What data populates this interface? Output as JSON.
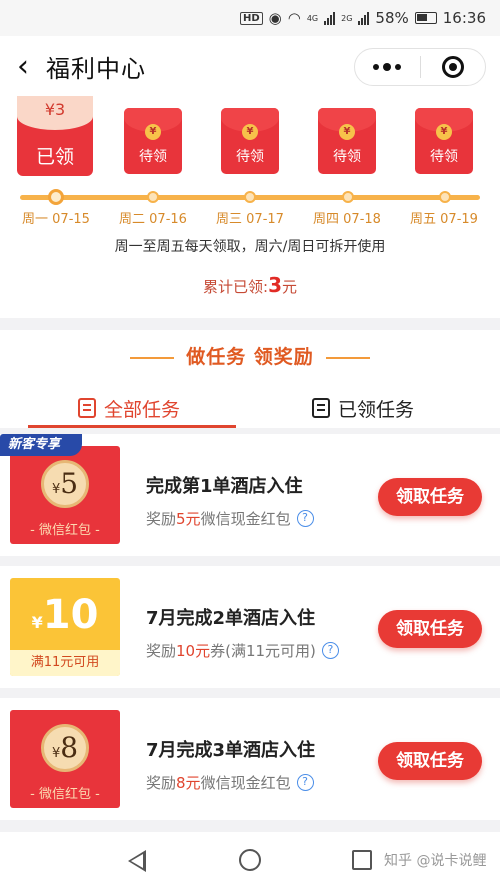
{
  "status_bar": {
    "battery": "58%",
    "time": "16:36",
    "hd": "HD",
    "net1": "4G",
    "net2": "2G"
  },
  "nav": {
    "back_icon": "chevron-left-icon",
    "title": "福利中心",
    "menu_icon": "more-dots-icon",
    "close_icon": "target-icon"
  },
  "checkin": {
    "claimed": {
      "amount": "¥3",
      "label": "已领"
    },
    "pending_label": "待领",
    "coin_glyph": "¥",
    "days": [
      "周一 07-15",
      "周二 07-16",
      "周三 07-17",
      "周四 07-18",
      "周五 07-19"
    ],
    "active_day": 0,
    "note": "周一至周五每天领取，周六/周日可拆开使用",
    "total_prefix": "累计已领:",
    "total_value": "3",
    "total_unit": "元"
  },
  "tasks_section": {
    "title": "做任务 领奖励",
    "tabs": [
      {
        "label": "全部任务",
        "active": true
      },
      {
        "label": "已领任务",
        "active": false
      }
    ]
  },
  "task_rows": [
    {
      "tag": "新客专享",
      "coupon": {
        "style": "red",
        "currency": "¥",
        "value": "5",
        "caption": "- 微信红包 -"
      },
      "title": "完成第1单酒店入住",
      "sub_prefix": "奖励",
      "sub_highlight": "5元",
      "sub_suffix": "微信现金红包",
      "button": "领取任务"
    },
    {
      "tag": "",
      "coupon": {
        "style": "yellow",
        "currency": "¥",
        "value": "10",
        "caption": "满11元可用"
      },
      "title": "7月完成2单酒店入住",
      "sub_prefix": "奖励",
      "sub_highlight": "10元",
      "sub_suffix": "券(满11元可用)",
      "button": "领取任务"
    },
    {
      "tag": "",
      "coupon": {
        "style": "red",
        "currency": "¥",
        "value": "8",
        "caption": "- 微信红包 -"
      },
      "title": "7月完成3单酒店入住",
      "sub_prefix": "奖励",
      "sub_highlight": "8元",
      "sub_suffix": "微信现金红包",
      "button": "领取任务"
    }
  ],
  "help_glyph": "?",
  "watermark": "知乎 @说卡说鲤",
  "colors": {
    "accent_red": "#e8343b",
    "track_orange": "#f7b24a",
    "tab_active": "#e0452f",
    "coupon_yellow": "#fbc437"
  }
}
